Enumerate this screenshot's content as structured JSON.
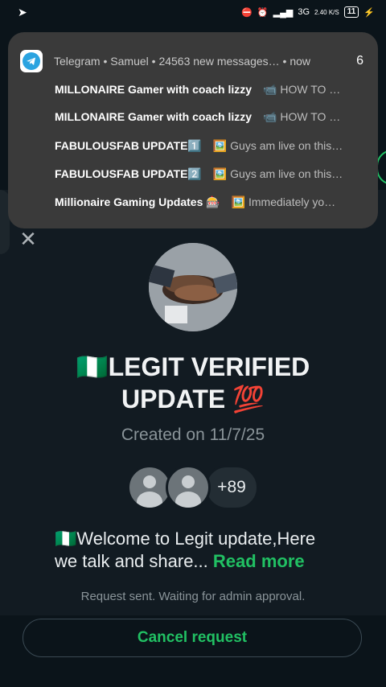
{
  "status_bar": {
    "left_icon": "telegram-send-icon",
    "network_label": "3G",
    "speed": "2.40 K/S",
    "battery": "11"
  },
  "notification": {
    "app": "Telegram",
    "sender": "Samuel",
    "summary": "24563 new messages…",
    "time": "now",
    "count": "6",
    "messages": [
      {
        "sender": "MILLONAIRE Gamer with coach lizzy",
        "text": "📹 HOW TO …"
      },
      {
        "sender": "MILLONAIRE Gamer with coach lizzy",
        "text": "📹 HOW TO …"
      },
      {
        "sender": "FABULOUSFAB UPDATE1️⃣",
        "text": "🖼️ Guys am live on this…"
      },
      {
        "sender": "FABULOUSFAB UPDATE2️⃣",
        "text": "🖼️ Guys am live on this…"
      },
      {
        "sender": "Millionaire Gaming Updates 🎰",
        "text": "🖼️ Immediately yo…"
      }
    ]
  },
  "group": {
    "title": "🇳🇬LEGIT VERIFIED UPDATE 💯",
    "created": "Created on 11/7/25",
    "extra_members": "+89",
    "description": "🇳🇬Welcome to Legit update,Here we talk and share...",
    "read_more": "Read more",
    "request_status": "Request sent. Waiting for admin approval.",
    "cancel_label": "Cancel request"
  }
}
